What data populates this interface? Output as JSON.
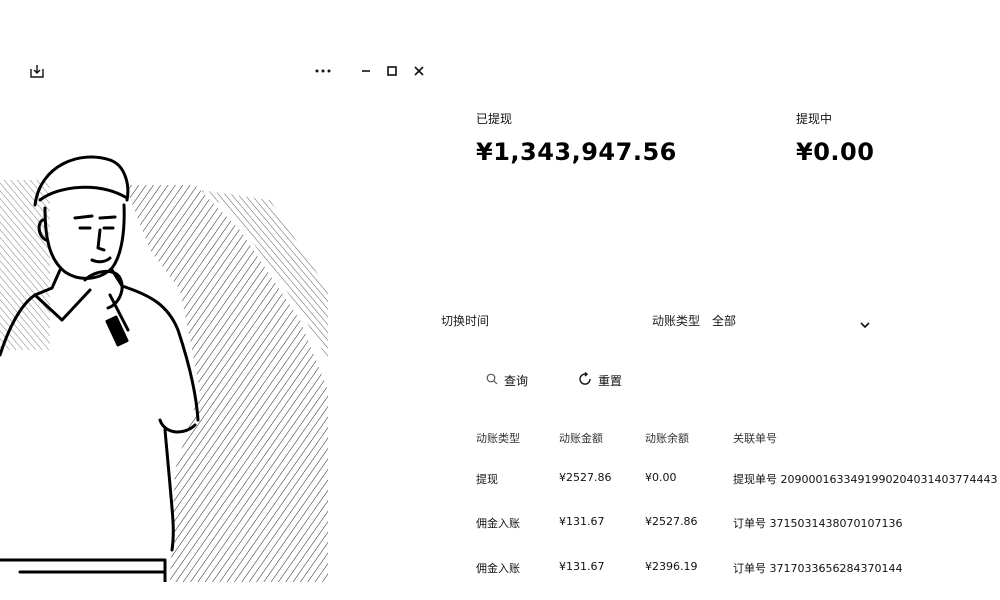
{
  "window": {
    "controls": [
      "download",
      "more",
      "minimize",
      "maximize",
      "close"
    ]
  },
  "stats": {
    "withdrawn_label": "已提现",
    "withdrawn_value": "¥1,343,947.56",
    "pending_label": "提现中",
    "pending_value": "¥0.00"
  },
  "filters": {
    "time_label": "切换时间",
    "type_label": "动账类型",
    "type_value": "全部",
    "query_label": "查询",
    "reset_label": "重置"
  },
  "table": {
    "headers": [
      "动账类型",
      "动账金额",
      "动账余额",
      "关联单号"
    ],
    "rows": [
      {
        "type": "提现",
        "amount": "¥2527.86",
        "balance": "¥0.00",
        "ref": "提现单号 2090001633491990204031403774443"
      },
      {
        "type": "佣金入账",
        "amount": "¥131.67",
        "balance": "¥2527.86",
        "ref": "订单号 3715031438070107136"
      },
      {
        "type": "佣金入账",
        "amount": "¥131.67",
        "balance": "¥2396.19",
        "ref": "订单号 3717033656284370144"
      }
    ]
  },
  "icons": {
    "download": "download-icon",
    "more": "more-icon",
    "minimize": "minimize-icon",
    "maximize": "maximize-icon",
    "close": "close-icon",
    "chevron": "chevron-down-icon",
    "query": "search-icon",
    "reset": "refresh-icon"
  }
}
